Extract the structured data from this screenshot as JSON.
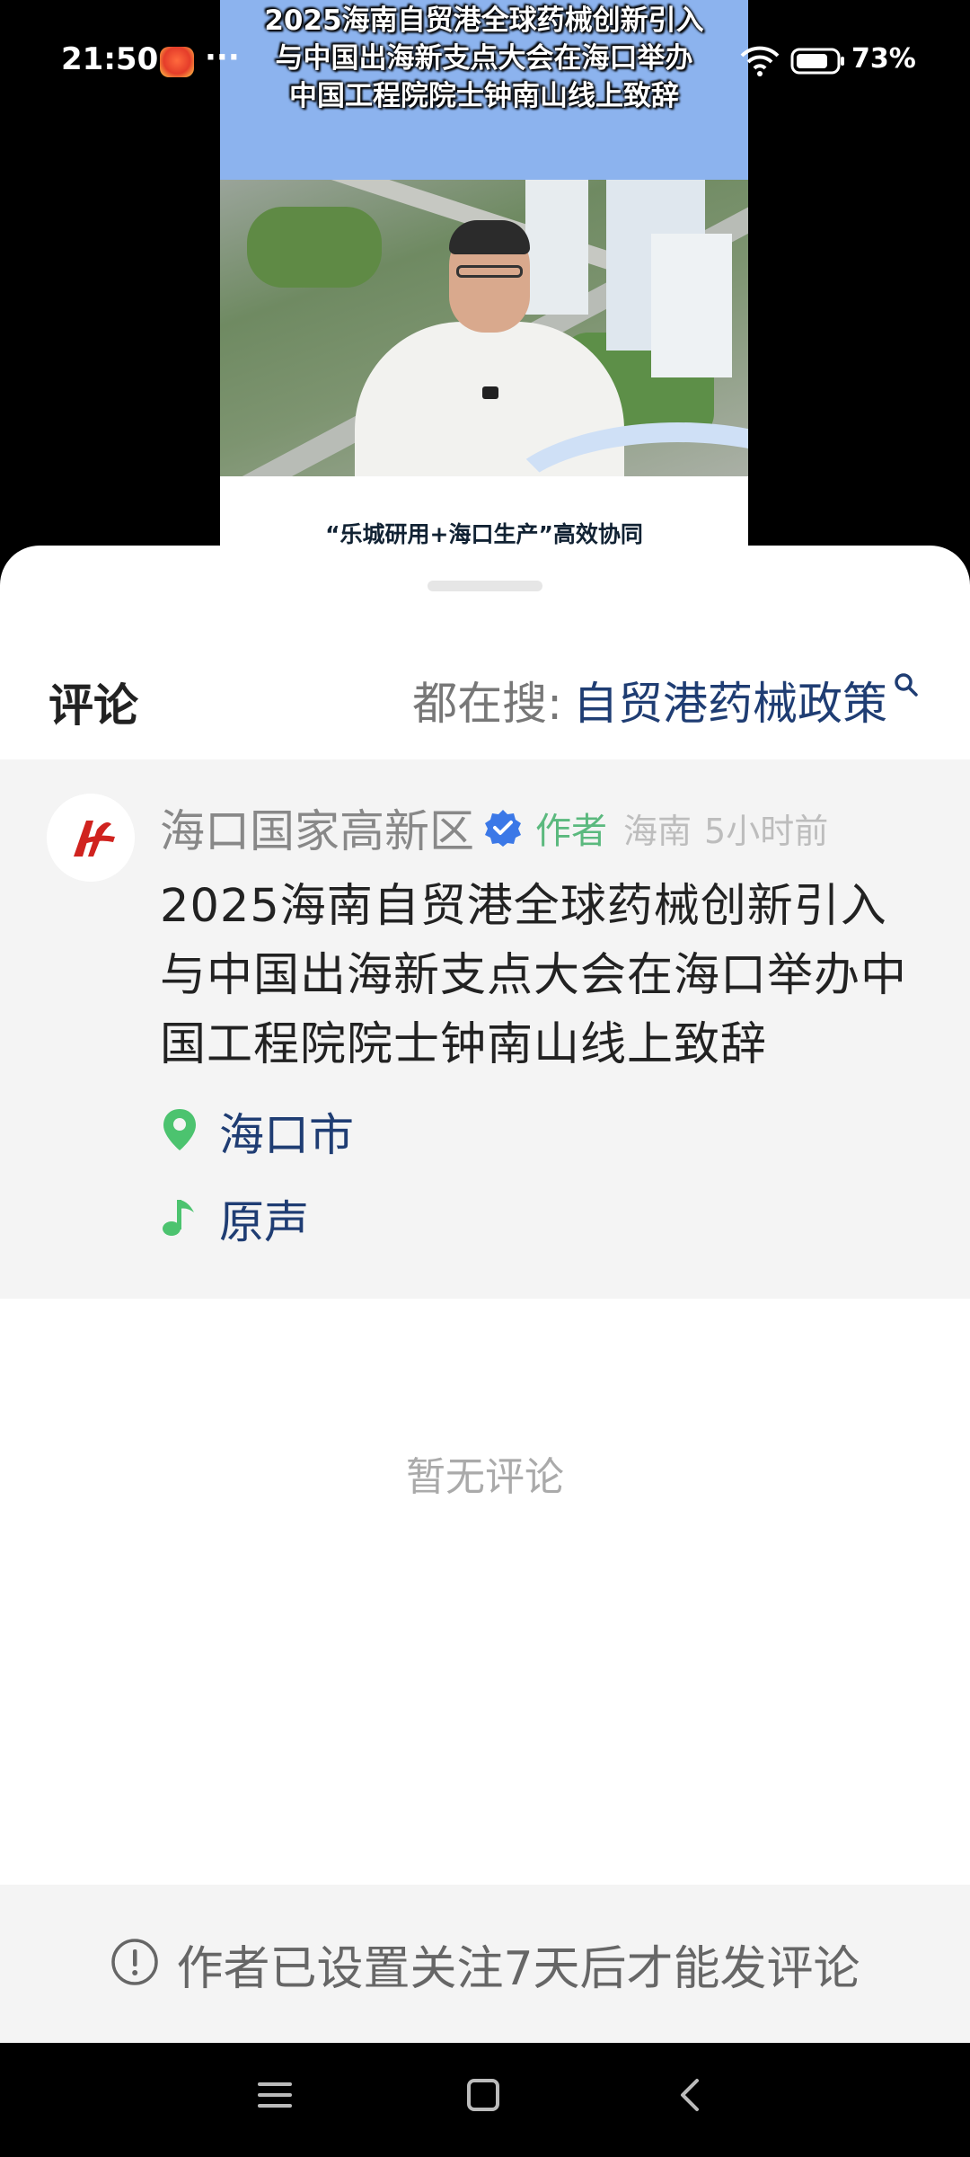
{
  "status_bar": {
    "time": "21:50",
    "more_indicator": "···",
    "battery_text": "73%",
    "icons": [
      "app-notification-icon",
      "wifi-icon",
      "battery-icon"
    ]
  },
  "video": {
    "title_lines": [
      "2025海南自贸港全球药械创新引入",
      "与中国出海新支点大会在海口举办",
      "中国工程院院士钟南山线上致辞"
    ],
    "caption": "“乐城研用+海口生产”高效协同"
  },
  "sheet": {
    "title": "评论",
    "search_prefix": "都在搜:",
    "search_term": "自贸港药械政策",
    "post": {
      "author_name": "海口国家高新区",
      "author_badge": "作者",
      "region": "海南",
      "time_ago": "5小时前",
      "text": "2025海南自贸港全球药械创新引入与中国出海新支点大会在海口举办中国工程院院士钟南山线上致辞",
      "location": "海口市",
      "music": "原声"
    },
    "empty_state": "暂无评论",
    "notice": "作者已设置关注7天后才能发评论"
  },
  "colors": {
    "accent_blue": "#1f3d73",
    "author_green": "#5bb97e",
    "verified_blue": "#3b78e7",
    "location_green": "#4cc36f"
  }
}
